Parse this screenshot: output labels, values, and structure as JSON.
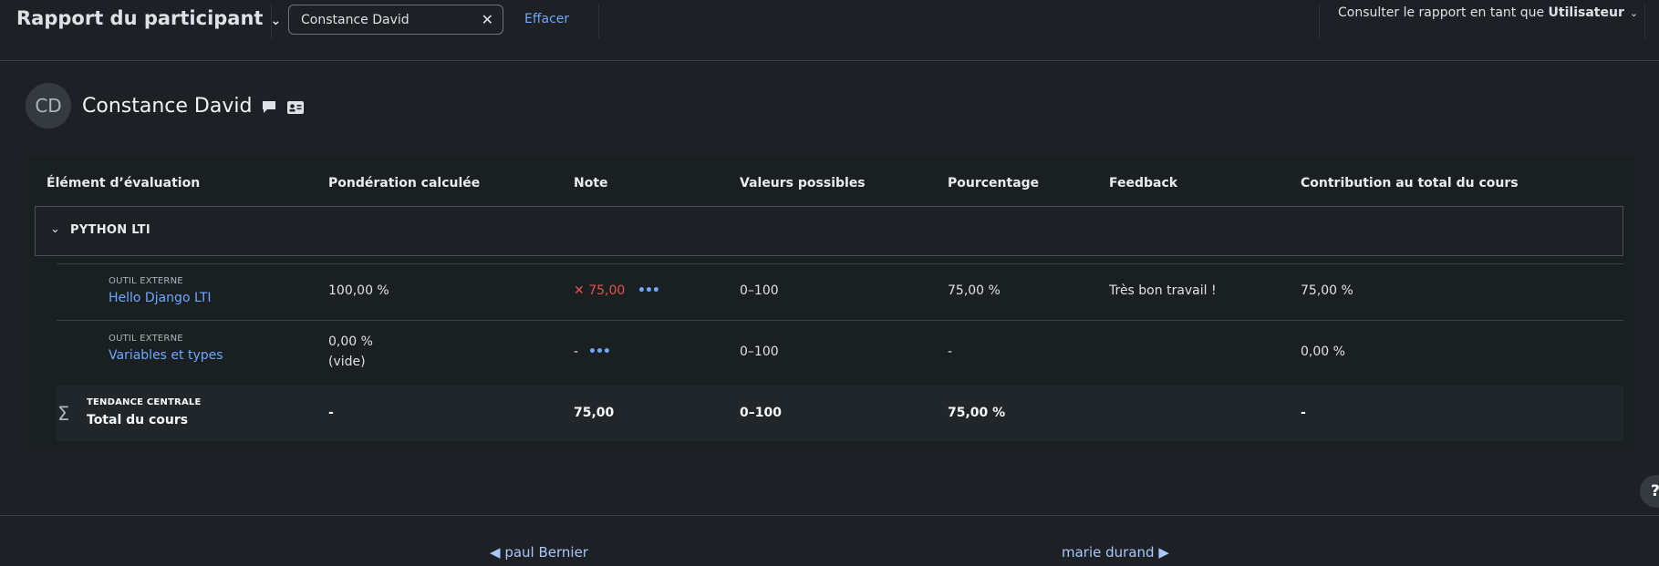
{
  "header": {
    "title": "Rapport du participant",
    "search": {
      "value": "Constance David"
    },
    "clear_label": "Effacer",
    "view_as_prefix": "Consulter le rapport en tant que",
    "view_as_value": "Utilisateur"
  },
  "user": {
    "initials": "CD",
    "name": "Constance David"
  },
  "table": {
    "headers": [
      "Élément d’évaluation",
      "Pondération calculée",
      "Note",
      "Valeurs possibles",
      "Pourcentage",
      "Feedback",
      "Contribution au total du cours"
    ],
    "category": "PYTHON LTI",
    "items": [
      {
        "type": "OUTIL EXTERNE",
        "name": "Hello Django LTI",
        "weight": "100,00 %",
        "weight_note": "",
        "grade": "75,00",
        "range": "0–100",
        "percentage": "75,00 %",
        "feedback": "Très bon travail !",
        "contribution": "75,00 %"
      },
      {
        "type": "OUTIL EXTERNE",
        "name": "Variables et types",
        "weight": "0,00 %",
        "weight_note": "(vide)",
        "grade": "-",
        "range": "0–100",
        "percentage": "-",
        "feedback": "",
        "contribution": "0,00 %"
      }
    ],
    "total": {
      "type": "TENDANCE CENTRALE",
      "name": "Total du cours",
      "weight": "-",
      "grade": "75,00",
      "range": "0–100",
      "percentage": "75,00 %",
      "contribution": "-"
    }
  },
  "nav": {
    "prev": "paul Bernier",
    "next": "marie durand"
  },
  "help": "?"
}
